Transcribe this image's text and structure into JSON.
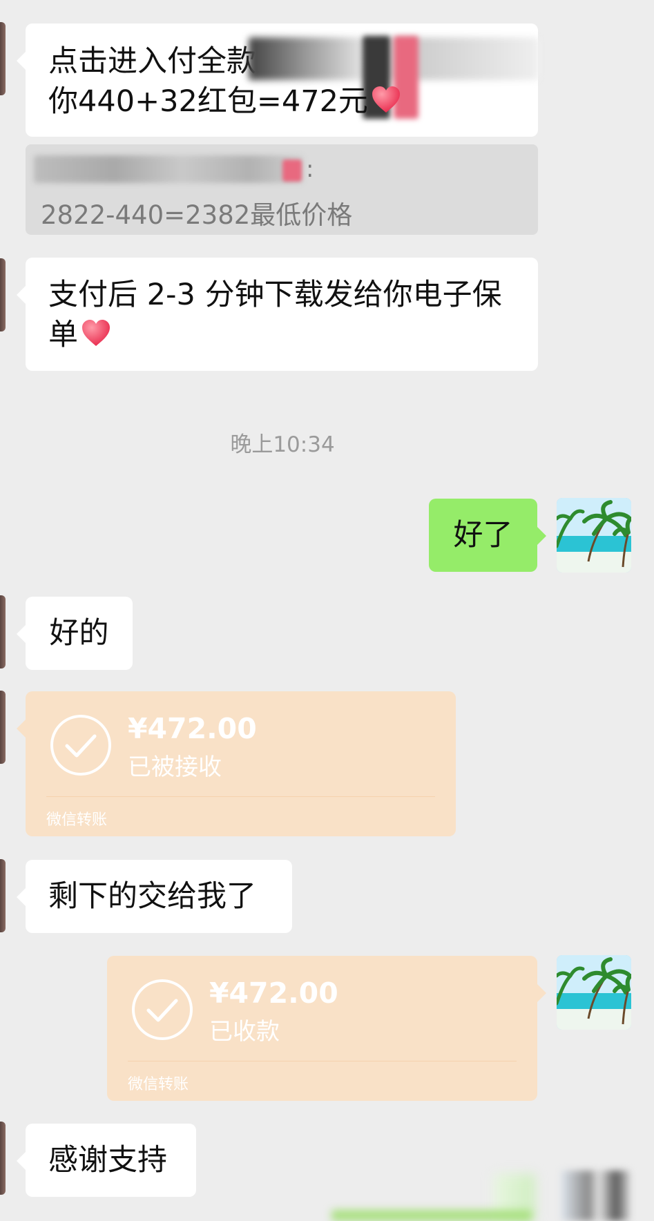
{
  "messages": {
    "m1_line1": "点击进入付全款",
    "m1_line2": "你440+32红包=472元",
    "quote_suffix": ":",
    "quote_text": "2822-440=2382最低价格",
    "m2_line1": "支付后 2-3 分钟下载发给你电子保",
    "m2_line2": "单",
    "timestamp": "晚上10:34",
    "sent_reply": "好了",
    "reply_ok": "好的",
    "leave_it": "剩下的交给我了",
    "thanks": "感谢支持"
  },
  "transfers": [
    {
      "amount": "¥472.00",
      "status": "已被接收",
      "label": "微信转账"
    },
    {
      "amount": "¥472.00",
      "status": "已收款",
      "label": "微信转账"
    }
  ],
  "icons": {
    "heart": "heart-emoji-icon",
    "check": "check-circle-icon",
    "avatar": "beach-palm-avatar"
  },
  "colors": {
    "background": "#ededed",
    "incoming_bubble": "#ffffff",
    "outgoing_bubble": "#95ec69",
    "transfer_card": "#f9e1c7",
    "timestamp_text": "#9a9a9a"
  }
}
